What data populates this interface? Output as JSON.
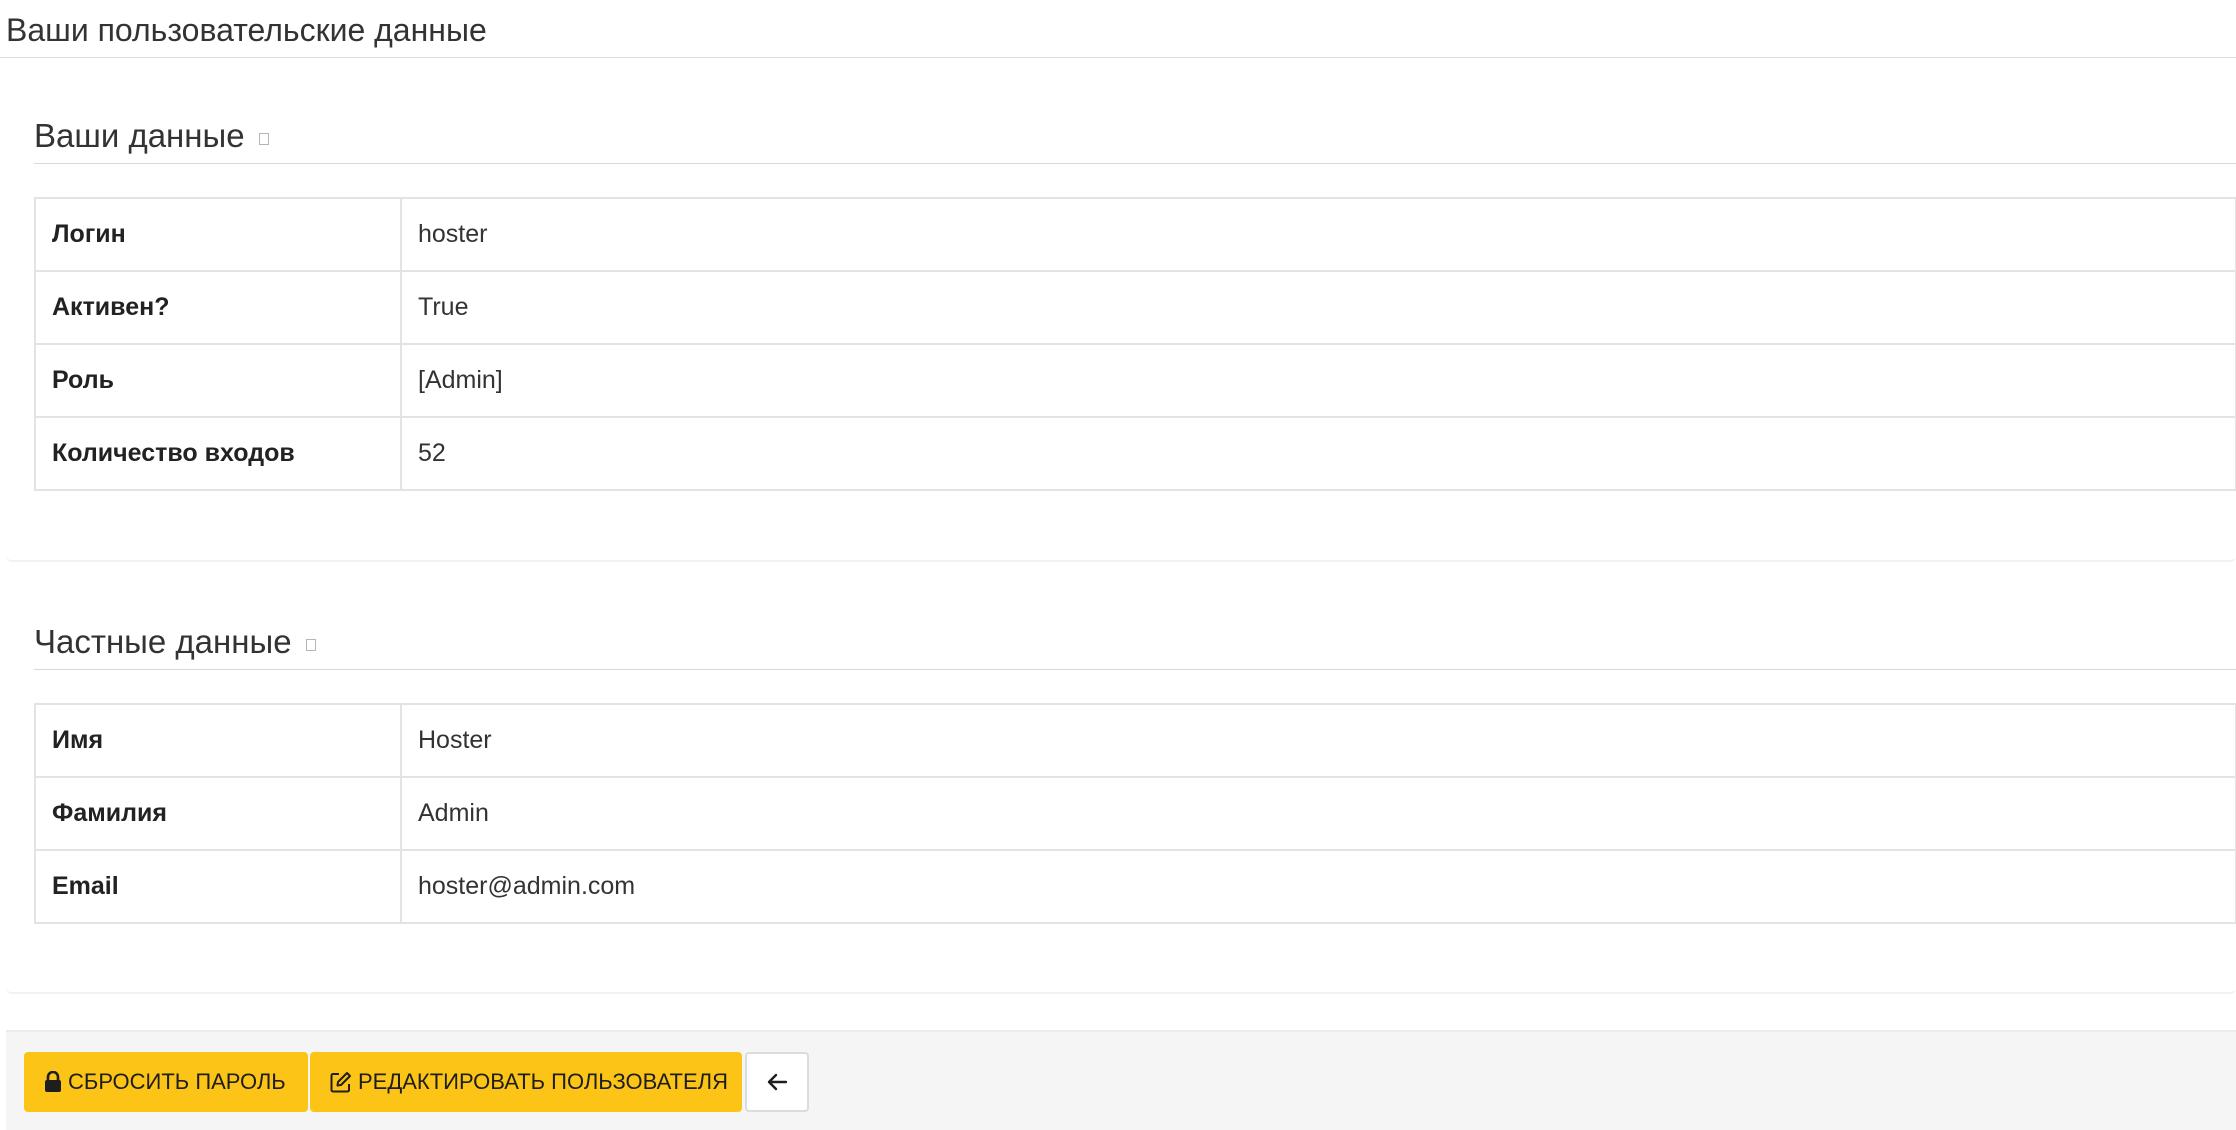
{
  "page": {
    "title": "Ваши пользовательские данные"
  },
  "user_section": {
    "title": "Ваши данные",
    "rows": [
      {
        "label": "Логин",
        "value": "hoster"
      },
      {
        "label": "Активен?",
        "value": "True"
      },
      {
        "label": "Роль",
        "value": "[Admin]"
      },
      {
        "label": "Количество входов",
        "value": "52"
      }
    ]
  },
  "private_section": {
    "title": "Частные данные",
    "rows": [
      {
        "label": "Имя",
        "value": "Hoster"
      },
      {
        "label": "Фамилия",
        "value": "Admin"
      },
      {
        "label": "Email",
        "value": "hoster@admin.com"
      }
    ]
  },
  "footer": {
    "reset_password_label": "СБРОСИТЬ ПАРОЛЬ",
    "edit_user_label": "РЕДАКТИРОВАТЬ ПОЛЬЗОВАТЕЛЯ",
    "icons": {
      "reset": "lock-icon",
      "edit": "edit-icon",
      "back": "arrow-left-icon"
    }
  },
  "colors": {
    "accent": "#fcc417",
    "border": "#e3e3e3",
    "footer_bg": "#f5f5f5"
  }
}
